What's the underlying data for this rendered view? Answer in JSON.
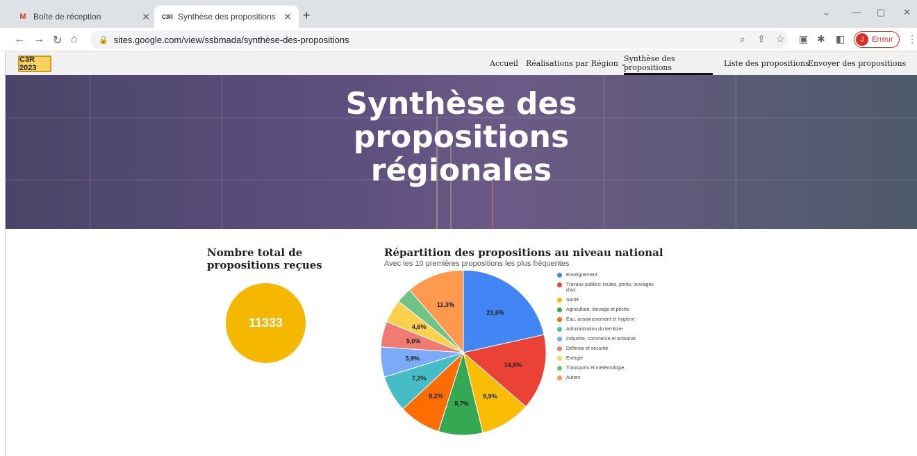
{
  "browser": {
    "tabs": [
      {
        "label": "Boîte de réception",
        "icon": "gmail-icon",
        "active": false
      },
      {
        "label": "Synthèse des propositions",
        "icon": "site-icon",
        "active": true
      }
    ],
    "url": "sites.google.com/view/ssbmada/synthèse-des-propositions",
    "profile_label": "Erreur",
    "profile_initial": "J"
  },
  "site": {
    "logo_text": "C3R 2023",
    "nav": [
      {
        "label": "Accueil"
      },
      {
        "label": "Réalisations par Région ⌄"
      },
      {
        "label": "Synthèse des propositions",
        "active": true
      },
      {
        "label": "Liste des propositions"
      },
      {
        "label": "Envoyer des propositions"
      }
    ]
  },
  "hero": {
    "title_line1": "Synthèse des",
    "title_line2": "propositions",
    "title_line3": "régionales"
  },
  "total": {
    "heading": "Nombre total de propositions reçues",
    "value": "11333"
  },
  "chart_data": {
    "type": "pie",
    "title": "Répartition des propositions au niveau national",
    "subtitle": "Avec les 10 premières propositions les plus fréquentes",
    "legend_position": "right",
    "slices": [
      {
        "name": "Enseignement",
        "value": 21.6,
        "label": "21,6%",
        "color": "#4285f4"
      },
      {
        "name": "Travaux publics: routes, ponts, ouvrages d'art",
        "value": 14.9,
        "label": "14,9%",
        "color": "#ea4335"
      },
      {
        "name": "Santé",
        "value": 9.9,
        "label": "9,9%",
        "color": "#fbbc04"
      },
      {
        "name": "Agriculture, élevage et pêche",
        "value": 8.7,
        "label": "8,7%",
        "color": "#34a853"
      },
      {
        "name": "Eau, assainissement et hygiène",
        "value": 8.2,
        "label": "8,2%",
        "color": "#ff6d01"
      },
      {
        "name": "Administration du territoire",
        "value": 7.2,
        "label": "7,2%",
        "color": "#46bdc6"
      },
      {
        "name": "Industrie, commerce et artisanat",
        "value": 5.9,
        "label": "5,9%",
        "color": "#7baaf7"
      },
      {
        "name": "Défense et sécurité",
        "value": 5.0,
        "label": "5,0%",
        "color": "#f07b72"
      },
      {
        "name": "Energie",
        "value": 4.6,
        "label": "4,6%",
        "color": "#fcd04f"
      },
      {
        "name": "Transports et météorologie",
        "value": 3.1,
        "label": "",
        "color": "#71c287"
      },
      {
        "name": "Autres",
        "value": 11.3,
        "label": "11,3%",
        "color": "#ff994d"
      }
    ]
  }
}
